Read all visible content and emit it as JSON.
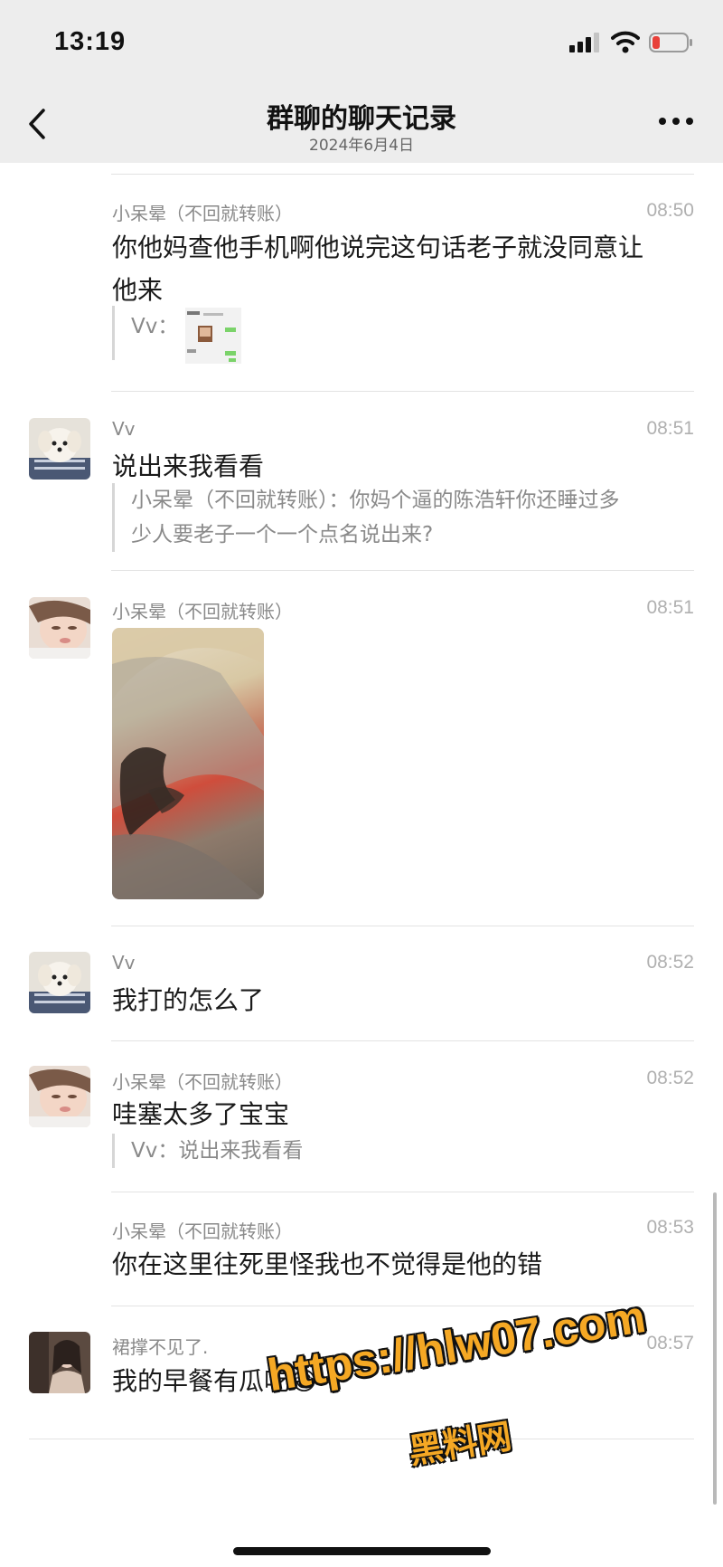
{
  "status_bar": {
    "time": "13:19"
  },
  "header": {
    "title": "群聊的聊天记录",
    "date": "2024年6月4日",
    "back_icon": "chevron-left-icon",
    "more_icon": "more-dots-icon"
  },
  "messages": [
    {
      "sender": "小呆晕（不回就转账）",
      "time": "08:50",
      "text_line1": "你他妈查他手机啊他说完这句话老子就没同意让",
      "text_line2": "他来",
      "quote_sender": "Vv："
    },
    {
      "sender": "Vv",
      "time": "08:51",
      "text": "说出来我看看",
      "quote_line1": "小呆晕（不回就转账）：你妈个逼的陈浩轩你还睡过多",
      "quote_line2": "少人要老子一个一个点名说出来?"
    },
    {
      "sender": "小呆晕（不回就转账）",
      "time": "08:51"
    },
    {
      "sender": "Vv",
      "time": "08:52",
      "text": "我打的怎么了"
    },
    {
      "sender": "小呆晕（不回就转账）",
      "time": "08:52",
      "text": "哇塞太多了宝宝",
      "quote": "Vv：说出来我看看"
    },
    {
      "sender": "小呆晕（不回就转账）",
      "time": "08:53",
      "text": "你在这里往死里怪我也不觉得是他的错"
    },
    {
      "sender": "裙撑不见了.",
      "time": "08:57",
      "text": "我的早餐有瓜吃",
      "emoji": "😂"
    }
  ],
  "watermark": {
    "url": "https://hlw07.com",
    "name": "黑料网"
  }
}
